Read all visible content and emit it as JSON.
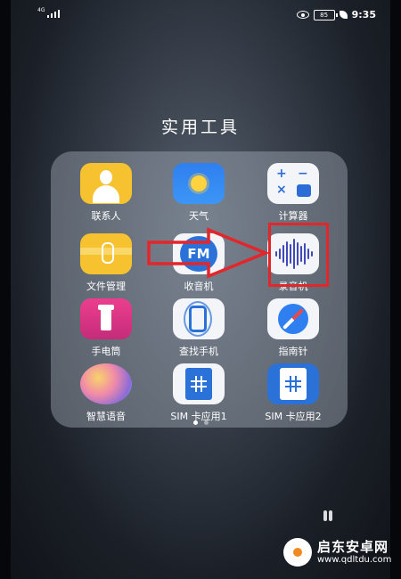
{
  "status_bar": {
    "signal_label": "4G",
    "battery_level": "85",
    "time": "9:35"
  },
  "folder": {
    "title": "实用工具",
    "apps": [
      {
        "label": "联系人",
        "icon": "contacts-icon"
      },
      {
        "label": "天气",
        "icon": "weather-icon"
      },
      {
        "label": "计算器",
        "icon": "calculator-icon"
      },
      {
        "label": "文件管理",
        "icon": "file-manager-icon"
      },
      {
        "label": "收音机",
        "icon": "fm-radio-icon",
        "icon_text": "FM"
      },
      {
        "label": "录音机",
        "icon": "sound-recorder-icon"
      },
      {
        "label": "手电筒",
        "icon": "flashlight-icon"
      },
      {
        "label": "查找手机",
        "icon": "find-phone-icon"
      },
      {
        "label": "指南针",
        "icon": "compass-icon"
      },
      {
        "label": "智慧语音",
        "icon": "smart-voice-icon"
      },
      {
        "label": "SIM 卡应用1",
        "icon": "sim-card-icon"
      },
      {
        "label": "SIM 卡应用2",
        "icon": "sim-card-icon"
      }
    ],
    "page_count": 2,
    "active_page": 1
  },
  "annotation": {
    "color": "#e3262a",
    "highlighted_app": "录音机"
  },
  "watermark": {
    "name": "启东安卓网",
    "url": "www.qdltdu.com"
  }
}
